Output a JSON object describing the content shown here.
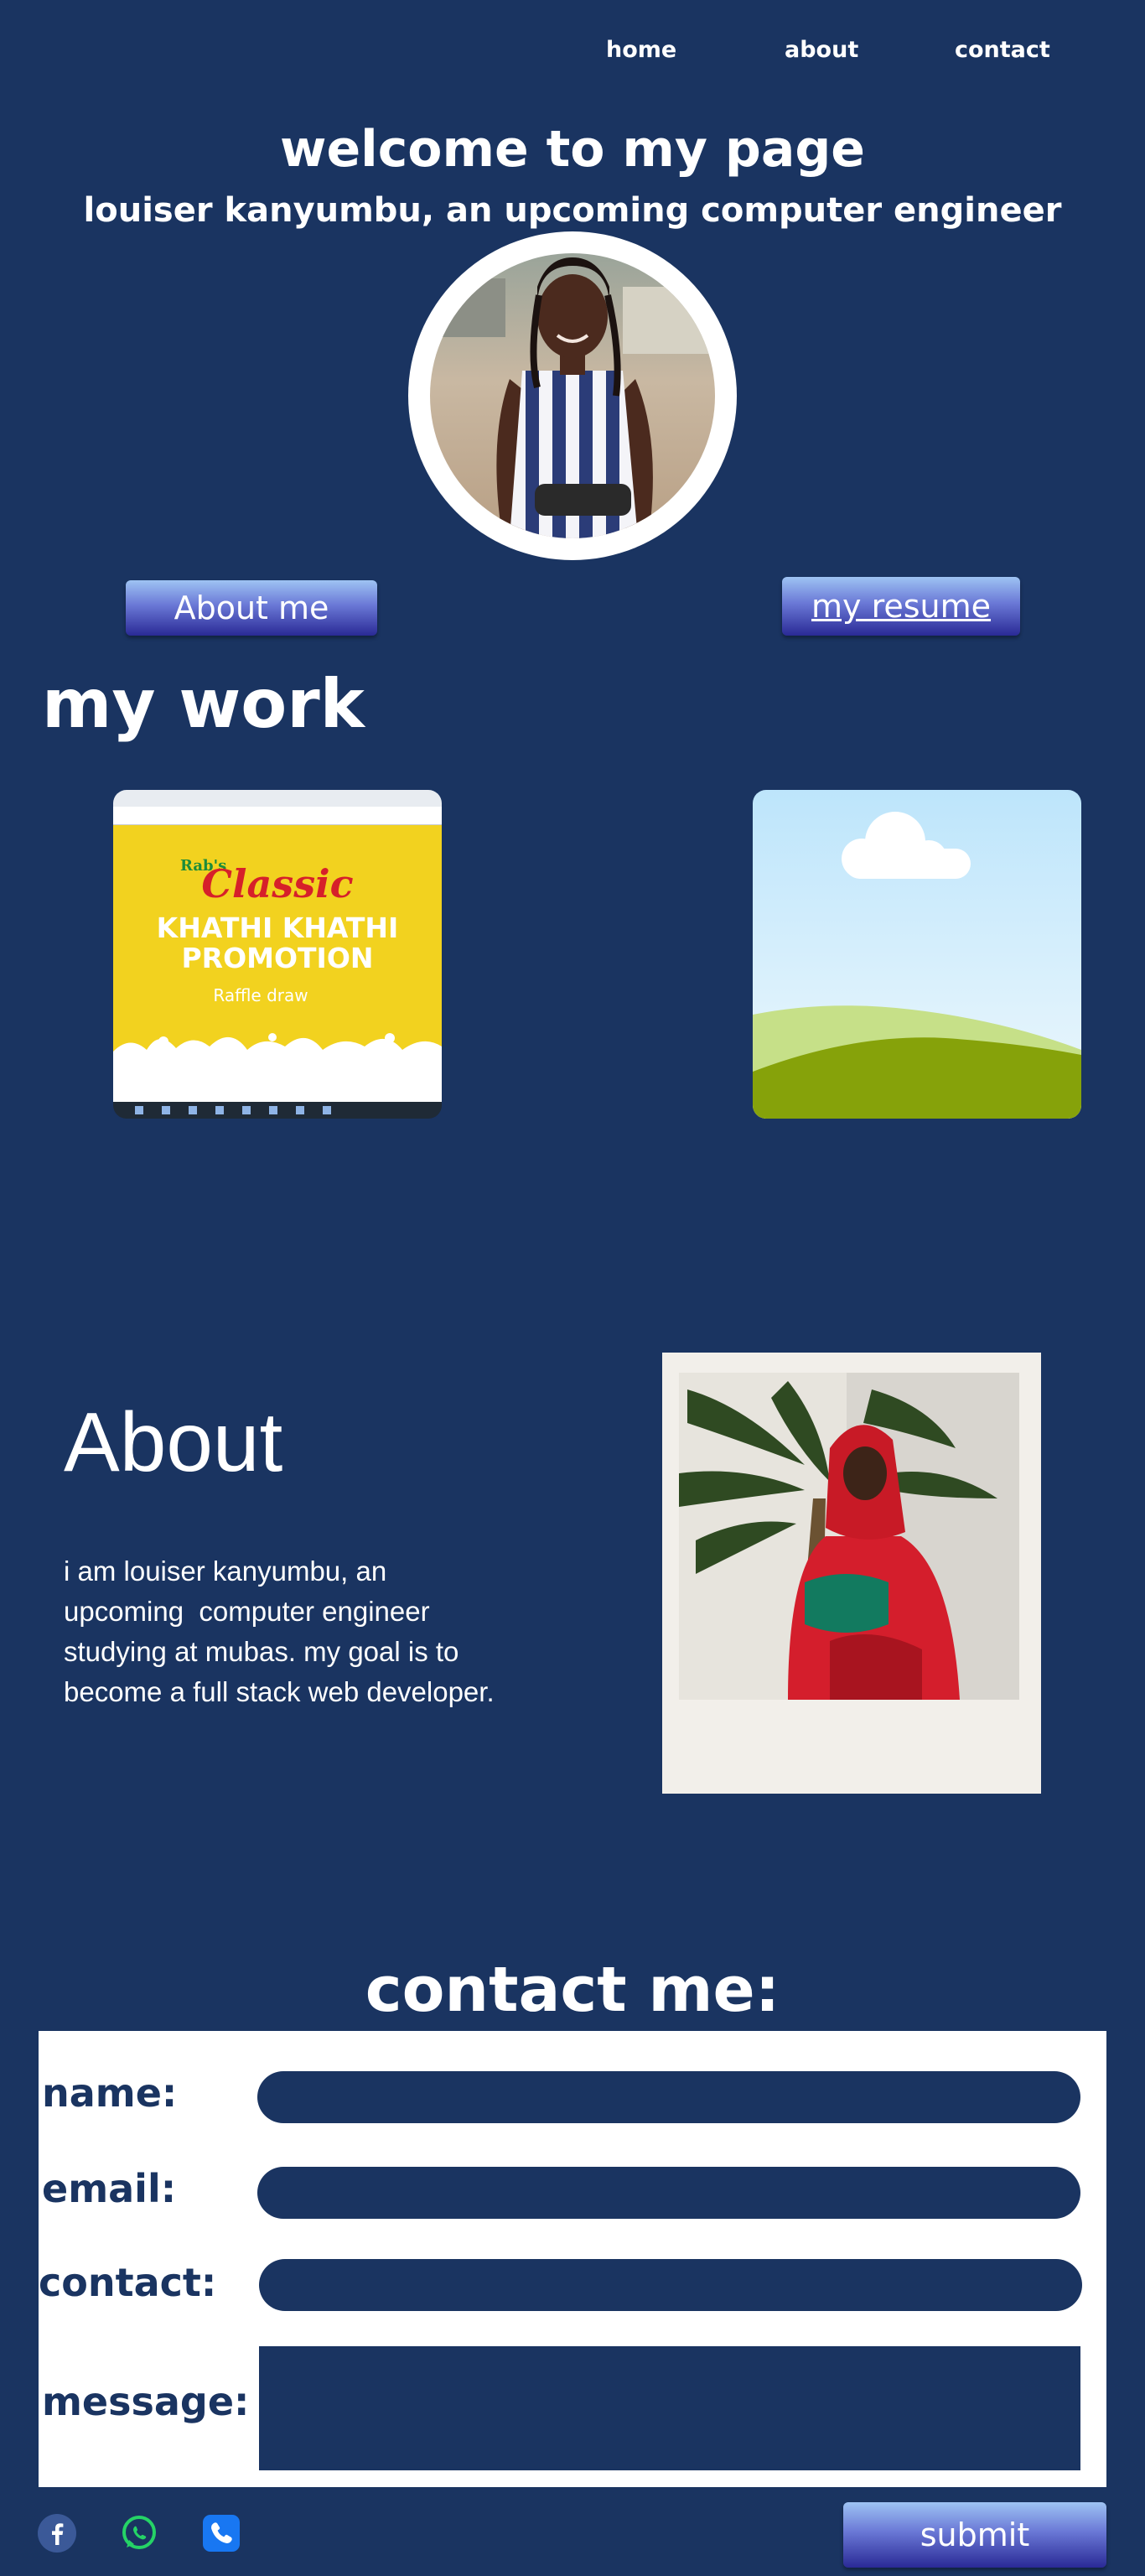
{
  "nav": {
    "home": "home",
    "about": "about",
    "contact": "contact"
  },
  "hero": {
    "title": "welcome to my page",
    "subtitle": "louiser kanyumbu, an upcoming computer engineer"
  },
  "buttons": {
    "about_me": "About me",
    "resume": "my resume"
  },
  "work": {
    "heading": "my work",
    "project_1": {
      "brand": "Rab's",
      "logo": "Classic",
      "line_1": "KHATHI KHATHI",
      "line_2": "PROMOTION",
      "line_3": "Raffle draw"
    }
  },
  "about": {
    "heading": "About",
    "text": "i am louiser kanyumbu, an upcoming  computer engineer studying at mubas. my goal is to become a full stack web developer."
  },
  "contact": {
    "heading": "contact me:",
    "name_label": "name:",
    "email_label": "email:",
    "contact_label": "contact:",
    "message_label": "message:",
    "submit": "submit"
  },
  "social": {
    "icons": [
      "facebook-icon",
      "whatsapp-icon",
      "phone-icon"
    ]
  },
  "colors": {
    "background": "#1a3461",
    "text": "#ffffff",
    "panel": "#ffffff",
    "button_top": "#9ec3f3",
    "button_bottom": "#2a2a96",
    "facebook": "#3b5998",
    "whatsapp": "#25d366",
    "phone": "#1877f2"
  }
}
